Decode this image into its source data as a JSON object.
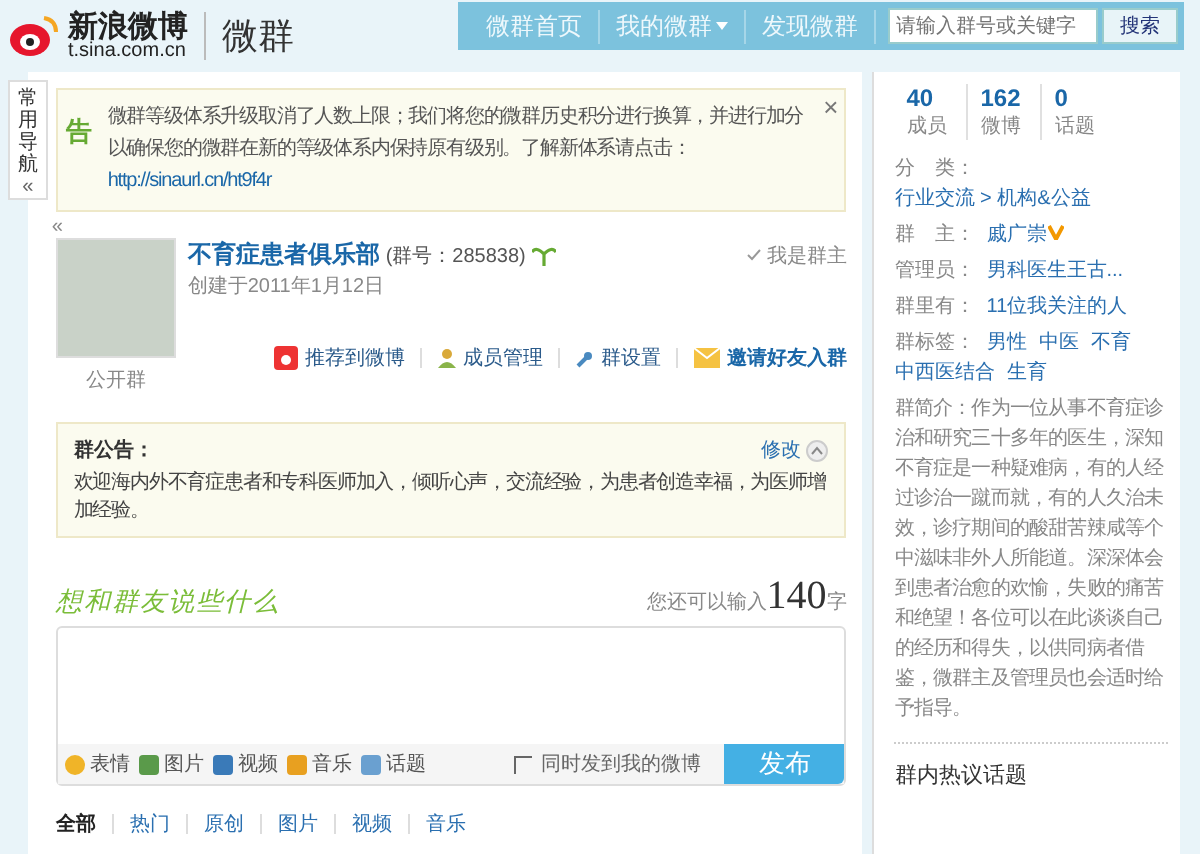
{
  "header": {
    "logo": {
      "brand": "新浪微博",
      "domain": "t.sina.com.cn",
      "product": "微群"
    },
    "nav": [
      {
        "label": "微群首页",
        "selected": false,
        "dropdown": false
      },
      {
        "label": "我的微群",
        "selected": false,
        "dropdown": true
      },
      {
        "label": "发现微群",
        "selected": false,
        "dropdown": false
      }
    ],
    "search": {
      "placeholder": "请输入群号或关键字",
      "button": "搜索"
    }
  },
  "side_nav": {
    "label": "常用导航",
    "toggle": "«"
  },
  "notice": {
    "tag": "告",
    "text": "微群等级体系升级取消了人数上限；我们将您的微群历史积分进行换算，并进行加分以确保您的微群在新的等级体系内保持原有级别。了解新体系请点击：",
    "link": "http://sinaurl.cn/ht9f4r",
    "close": "×"
  },
  "group": {
    "collapse": "«",
    "name": "不育症患者俱乐部",
    "id": "(群号：285838)",
    "created": "创建于2011年1月12日",
    "type": "公开群",
    "owner_badge": "我是群主",
    "actions": [
      {
        "label": "推荐到微博",
        "kind": "share"
      },
      {
        "label": "成员管理",
        "kind": "members"
      },
      {
        "label": "群设置",
        "kind": "settings"
      },
      {
        "label": "邀请好友入群",
        "kind": "invite"
      }
    ]
  },
  "announcement": {
    "title": "群公告：",
    "text": "欢迎海内外不育症患者和专科医师加入，倾听心声，交流经验，为患者创造幸福，为医师增加经验。",
    "edit": "修改",
    "expanded": true
  },
  "composer": {
    "title": "想和群友说些什么",
    "counter_prefix": "您还可以输入",
    "count": "140",
    "counter_suffix": "字",
    "tools": [
      {
        "label": "表情",
        "kind": "emoji"
      },
      {
        "label": "图片",
        "kind": "image"
      },
      {
        "label": "视频",
        "kind": "video"
      },
      {
        "label": "音乐",
        "kind": "music"
      },
      {
        "label": "话题",
        "kind": "topic"
      }
    ],
    "sync": {
      "label": "同时发到我的微博",
      "checked": false
    },
    "submit": "发布"
  },
  "feed_tabs": [
    {
      "label": "全部",
      "selected": true
    },
    {
      "label": "热门",
      "selected": false
    },
    {
      "label": "原创",
      "selected": false
    },
    {
      "label": "图片",
      "selected": false
    },
    {
      "label": "视频",
      "selected": false
    },
    {
      "label": "音乐",
      "selected": false
    }
  ],
  "sidebar": {
    "stats": [
      {
        "value": "40",
        "label": "成员"
      },
      {
        "value": "162",
        "label": "微博"
      },
      {
        "value": "0",
        "label": "话题"
      }
    ],
    "category": {
      "label": "分　类：",
      "path": [
        "行业交流",
        "机构&公益"
      ],
      "separator": ">"
    },
    "owner": {
      "label": "群　主：",
      "name": "戚广崇",
      "verified": true
    },
    "admins": {
      "label": "管理员：",
      "name": "男科医生王古..."
    },
    "following": {
      "label": "群里有：",
      "text": "11位我关注的人"
    },
    "tags": {
      "label": "群标签：",
      "items": [
        "男性",
        "中医",
        "不育",
        "中西医结合",
        "生育"
      ]
    },
    "intro": {
      "label": "群简介：",
      "text": "作为一位从事不育症诊治和研究三十多年的医生，深知不育症是一种疑难病，有的人经过诊治一蹴而就，有的人久治未效，诊疗期间的酸甜苦辣咸等个中滋味非外人所能道。深深体会到患者治愈的欢愉，失败的痛苦和绝望！各位可以在此谈谈自己的经历和得失，以供同病者借鉴，微群主及管理员也会适时给予指导。"
    },
    "hot_topics": "群内热议话题"
  }
}
